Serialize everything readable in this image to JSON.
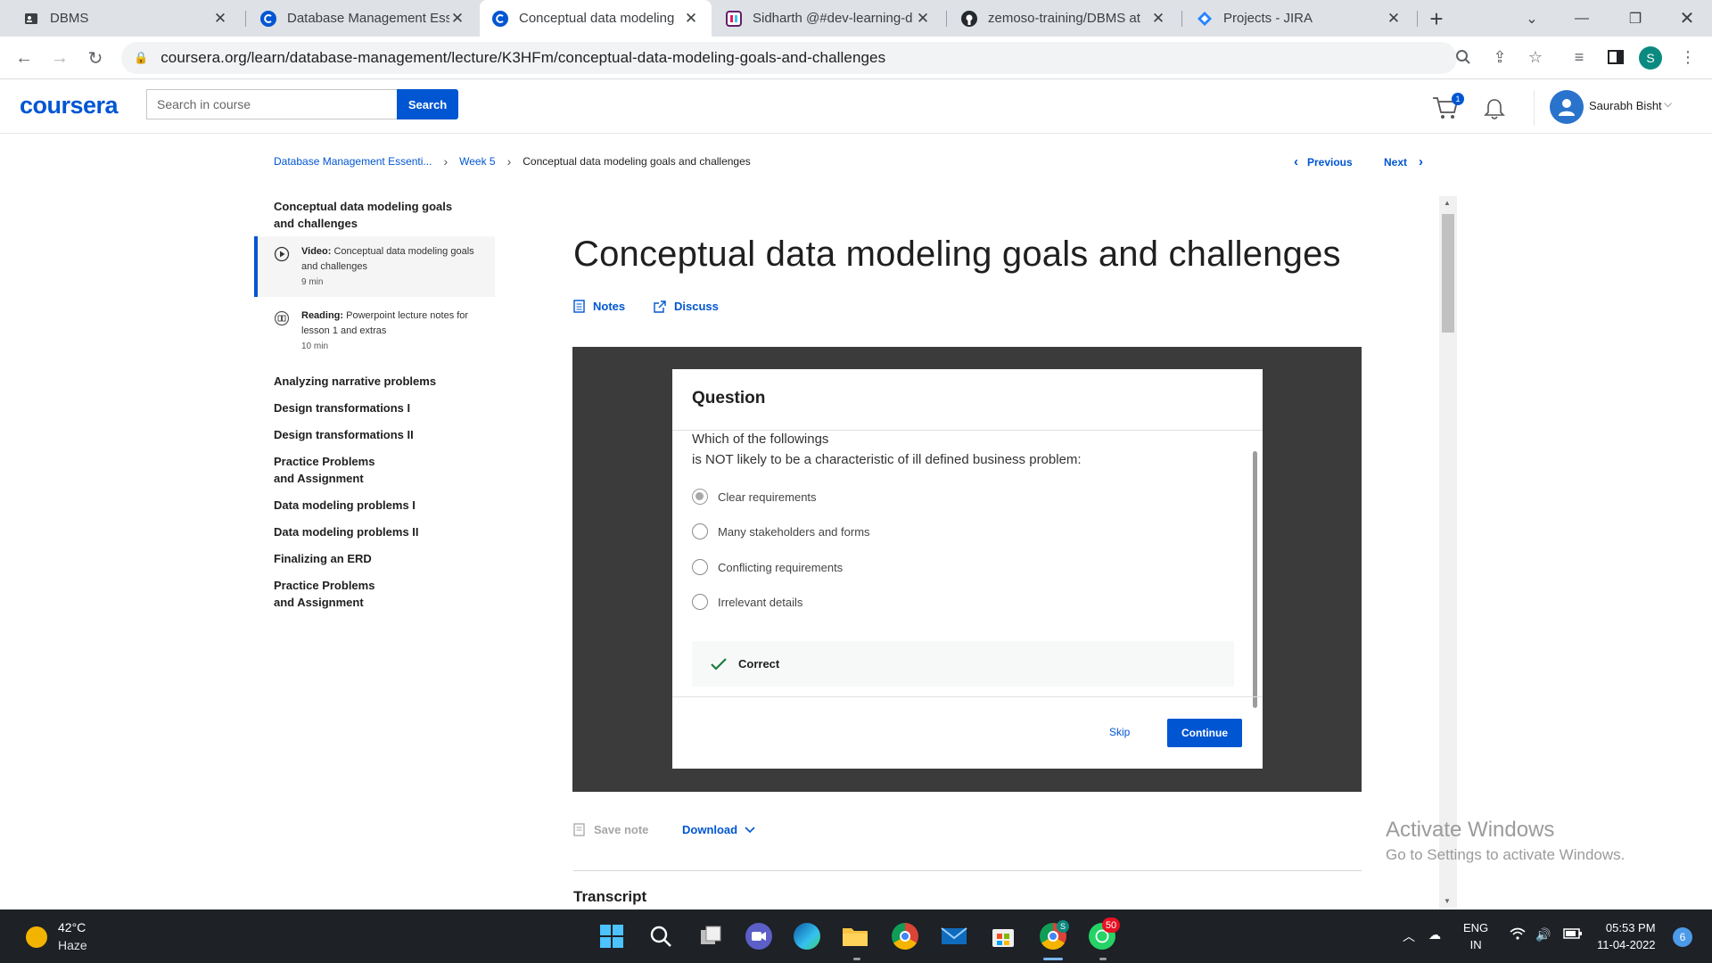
{
  "browser": {
    "tabs": [
      {
        "label": "DBMS",
        "icon": "contact-icon"
      },
      {
        "label": "Database Management Ess",
        "icon": "coursera-icon"
      },
      {
        "label": "Conceptual data modeling",
        "icon": "coursera-icon"
      },
      {
        "label": "Sidharth @#dev-learning-d",
        "icon": "slack-icon"
      },
      {
        "label": "zemoso-training/DBMS at",
        "icon": "github-icon"
      },
      {
        "label": "Projects - JIRA",
        "icon": "jira-icon"
      }
    ],
    "url": "coursera.org/learn/database-management/lecture/K3HFm/conceptual-data-modeling-goals-and-challenges",
    "profile_initial": "S"
  },
  "header": {
    "logo": "coursera",
    "search_placeholder": "Search in course",
    "search_button": "Search",
    "cart_count": "1",
    "user_name": "Saurabh Bisht"
  },
  "breadcrumb": {
    "course": "Database Management Essenti...",
    "week": "Week 5",
    "current": "Conceptual data modeling goals and challenges",
    "previous": "Previous",
    "next": "Next"
  },
  "sidebar": {
    "section_title": "Conceptual data modeling goals and challenges",
    "items": [
      {
        "type": "Video:",
        "title": "Conceptual data modeling goals and challenges",
        "duration": "9 min"
      },
      {
        "type": "Reading:",
        "title": "Powerpoint lecture notes for lesson 1 and extras",
        "duration": "10 min"
      }
    ],
    "links": [
      "Analyzing narrative problems",
      "Design transformations I",
      "Design transformations II",
      "Practice Problems and Assignment",
      "Data modeling problems I",
      "Data modeling problems II",
      "Finalizing an ERD",
      "Practice Problems and Assignment"
    ]
  },
  "main": {
    "title": "Conceptual data modeling goals and challenges",
    "notes_label": "Notes",
    "discuss_label": "Discuss",
    "save_note": "Save note",
    "download": "Download",
    "transcript": "Transcript"
  },
  "question": {
    "heading": "Question",
    "text_line1": "Which of the followings",
    "text_line2": "is NOT likely to be a characteristic of ill defined business problem:",
    "options": [
      "Clear requirements",
      "Many stakeholders and forms",
      "Conflicting requirements",
      "Irrelevant details"
    ],
    "selected_index": 0,
    "result": "Correct",
    "skip": "Skip",
    "continue": "Continue"
  },
  "watermark": {
    "line1": "Activate Windows",
    "line2": "Go to Settings to activate Windows."
  },
  "taskbar": {
    "temperature": "42°C",
    "weather": "Haze",
    "whatsapp_badge": "50",
    "chrome_badge": "S",
    "lang_line1": "ENG",
    "lang_line2": "IN",
    "time": "05:53 PM",
    "date": "11-04-2022",
    "notifications": "6"
  }
}
